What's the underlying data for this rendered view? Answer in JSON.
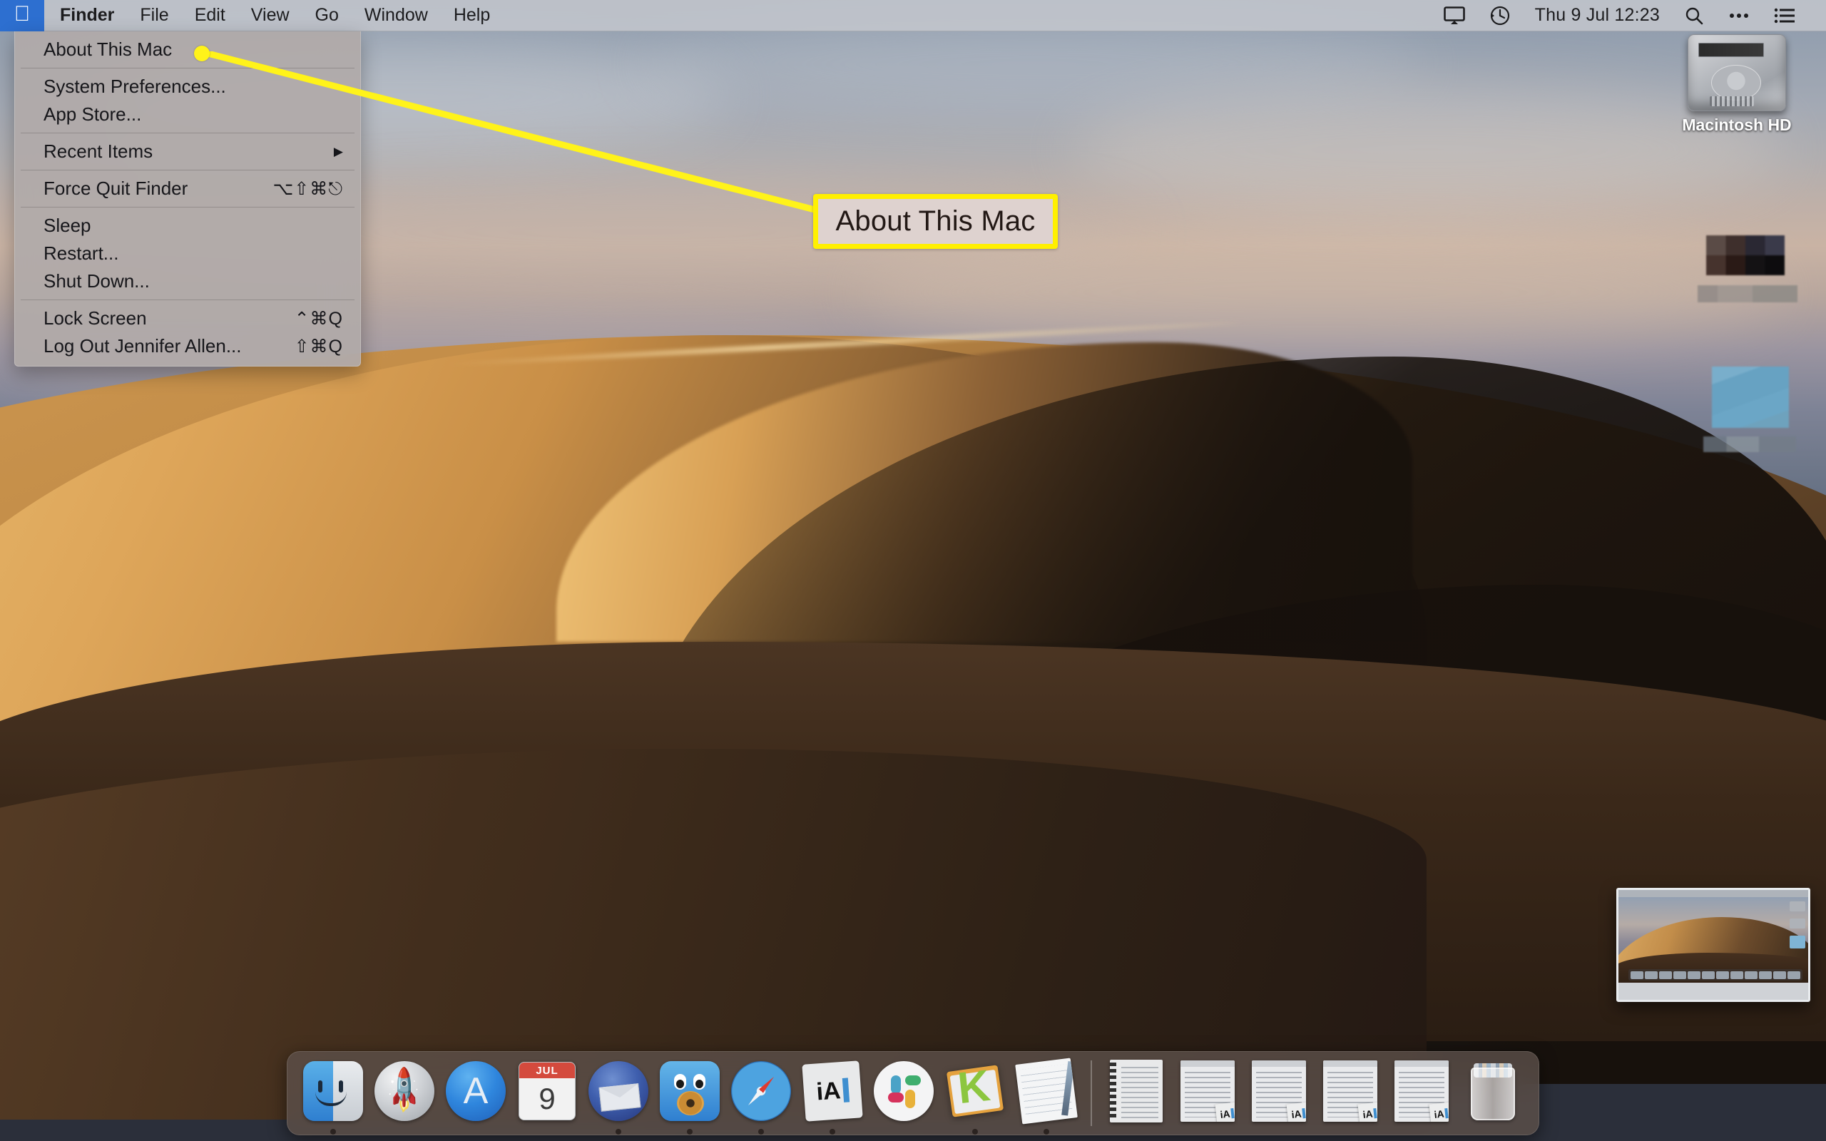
{
  "menubar": {
    "apple_icon": "apple-logo-icon",
    "items": [
      {
        "label": "Finder",
        "bold": true
      },
      {
        "label": "File",
        "bold": false
      },
      {
        "label": "Edit",
        "bold": false
      },
      {
        "label": "View",
        "bold": false
      },
      {
        "label": "Go",
        "bold": false
      },
      {
        "label": "Window",
        "bold": false
      },
      {
        "label": "Help",
        "bold": false
      }
    ],
    "status": {
      "display_icon": "display-icon",
      "time_machine_icon": "time-machine-icon",
      "clock": "Thu 9 Jul  12:23",
      "search_icon": "search-icon",
      "siri_icon": "siri-icon",
      "control_center_icon": "list-icon"
    }
  },
  "apple_menu": {
    "groups": [
      [
        {
          "label": "About This Mac",
          "accel": "",
          "submenu": false
        }
      ],
      [
        {
          "label": "System Preferences...",
          "accel": "",
          "submenu": false
        },
        {
          "label": "App Store...",
          "accel": "",
          "submenu": false
        }
      ],
      [
        {
          "label": "Recent Items",
          "accel": "",
          "submenu": true
        }
      ],
      [
        {
          "label": "Force Quit Finder",
          "accel": "⌥⇧⌘⎋",
          "submenu": false
        }
      ],
      [
        {
          "label": "Sleep",
          "accel": "",
          "submenu": false
        },
        {
          "label": "Restart...",
          "accel": "",
          "submenu": false
        },
        {
          "label": "Shut Down...",
          "accel": "",
          "submenu": false
        }
      ],
      [
        {
          "label": "Lock Screen",
          "accel": "⌃⌘Q",
          "submenu": false
        },
        {
          "label": "Log Out Jennifer Allen...",
          "accel": "⇧⌘Q",
          "submenu": false
        }
      ]
    ],
    "submenu_arrow": "▶"
  },
  "callout": {
    "text": "About This Mac",
    "border_color": "#fff000",
    "fill_color": "#ded2cf"
  },
  "desktop": {
    "icons": [
      {
        "label": "Macintosh HD",
        "icon": "hard-drive-icon"
      }
    ],
    "censored_icons": 2
  },
  "dock": {
    "apps": [
      {
        "name": "Finder",
        "icon": "finder-icon",
        "running": true
      },
      {
        "name": "Launchpad",
        "icon": "launchpad-icon",
        "running": false
      },
      {
        "name": "App Store",
        "icon": "app-store-icon",
        "running": false
      },
      {
        "name": "Calendar",
        "icon": "calendar-icon",
        "running": false,
        "month": "JUL",
        "day": "9"
      },
      {
        "name": "Thunderbird",
        "icon": "thunderbird-icon",
        "running": true
      },
      {
        "name": "Tweetbot",
        "icon": "tweetbot-icon",
        "running": true
      },
      {
        "name": "Safari",
        "icon": "safari-icon",
        "running": true
      },
      {
        "name": "iA Writer",
        "icon": "ia-writer-icon",
        "running": true,
        "wordmark": "iA"
      },
      {
        "name": "Slack",
        "icon": "slack-icon",
        "running": false
      },
      {
        "name": "Mail",
        "icon": "kmail-icon",
        "running": true,
        "letter": "K"
      },
      {
        "name": "Notes",
        "icon": "notes-icon",
        "running": true
      }
    ],
    "minimized": [
      {
        "name": "Spiral Notebook Document",
        "icon": "document-thumbnail-icon"
      },
      {
        "name": "Text Document 1",
        "icon": "document-thumbnail-icon",
        "badge": "iA"
      },
      {
        "name": "Text Document 2",
        "icon": "document-thumbnail-icon",
        "badge": "iA"
      },
      {
        "name": "Text Document 3",
        "icon": "document-thumbnail-icon",
        "badge": "iA"
      },
      {
        "name": "Text Document 4",
        "icon": "document-thumbnail-icon",
        "badge": "iA"
      }
    ],
    "trash": {
      "name": "Trash",
      "icon": "trash-full-icon"
    }
  },
  "screenshot_thumbnail": {
    "name": "screenshot-preview"
  }
}
